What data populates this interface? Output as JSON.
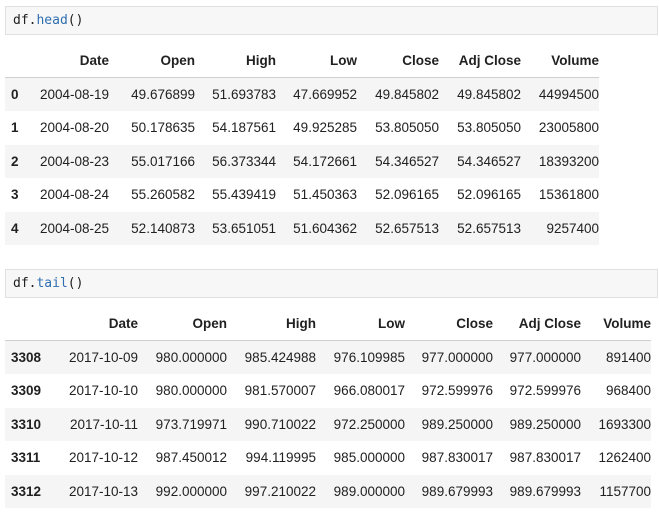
{
  "cells": [
    {
      "code_obj": "df.",
      "code_fn": "head",
      "code_args": "()",
      "columns": [
        "Date",
        "Open",
        "High",
        "Low",
        "Close",
        "Adj Close",
        "Volume"
      ],
      "rows": [
        {
          "index": "0",
          "values": [
            "2004-08-19",
            "49.676899",
            "51.693783",
            "47.669952",
            "49.845802",
            "49.845802",
            "44994500"
          ]
        },
        {
          "index": "1",
          "values": [
            "2004-08-20",
            "50.178635",
            "54.187561",
            "49.925285",
            "53.805050",
            "53.805050",
            "23005800"
          ]
        },
        {
          "index": "2",
          "values": [
            "2004-08-23",
            "55.017166",
            "56.373344",
            "54.172661",
            "54.346527",
            "54.346527",
            "18393200"
          ]
        },
        {
          "index": "3",
          "values": [
            "2004-08-24",
            "55.260582",
            "55.439419",
            "51.450363",
            "52.096165",
            "52.096165",
            "15361800"
          ]
        },
        {
          "index": "4",
          "values": [
            "2004-08-25",
            "52.140873",
            "53.651051",
            "51.604362",
            "52.657513",
            "52.657513",
            "9257400"
          ]
        }
      ]
    },
    {
      "code_obj": "df.",
      "code_fn": "tail",
      "code_args": "()",
      "columns": [
        "Date",
        "Open",
        "High",
        "Low",
        "Close",
        "Adj Close",
        "Volume"
      ],
      "rows": [
        {
          "index": "3308",
          "values": [
            "2017-10-09",
            "980.000000",
            "985.424988",
            "976.109985",
            "977.000000",
            "977.000000",
            "891400"
          ]
        },
        {
          "index": "3309",
          "values": [
            "2017-10-10",
            "980.000000",
            "981.570007",
            "966.080017",
            "972.599976",
            "972.599976",
            "968400"
          ]
        },
        {
          "index": "3310",
          "values": [
            "2017-10-11",
            "973.719971",
            "990.710022",
            "972.250000",
            "989.250000",
            "989.250000",
            "1693300"
          ]
        },
        {
          "index": "3311",
          "values": [
            "2017-10-12",
            "987.450012",
            "994.119995",
            "985.000000",
            "987.830017",
            "987.830017",
            "1262400"
          ]
        },
        {
          "index": "3312",
          "values": [
            "2017-10-13",
            "992.000000",
            "997.210022",
            "989.000000",
            "989.679993",
            "989.679993",
            "1157700"
          ]
        }
      ]
    }
  ]
}
